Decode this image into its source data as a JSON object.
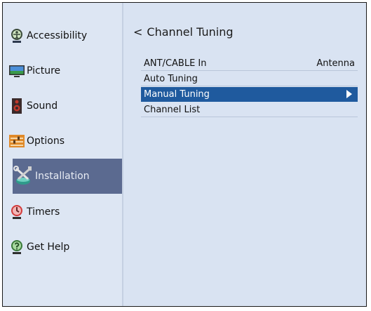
{
  "sidebar": {
    "items": [
      {
        "label": "Accessibility",
        "icon": "accessibility-icon"
      },
      {
        "label": "Picture",
        "icon": "picture-icon"
      },
      {
        "label": "Sound",
        "icon": "speaker-icon"
      },
      {
        "label": "Options",
        "icon": "options-icon"
      },
      {
        "label": "Installation",
        "icon": "tools-icon",
        "active": true
      },
      {
        "label": "Timers",
        "icon": "timer-icon"
      },
      {
        "label": "Get Help",
        "icon": "help-icon"
      }
    ]
  },
  "main": {
    "back_symbol": "<",
    "title": "Channel Tuning",
    "menu": [
      {
        "label": "ANT/CABLE In",
        "value": "Antenna"
      },
      {
        "label": "Auto Tuning",
        "value": ""
      },
      {
        "label": "Manual Tuning",
        "value": "",
        "selected": true
      },
      {
        "label": "Channel List",
        "value": ""
      }
    ]
  },
  "colors": {
    "background": "#d9e3f2",
    "sidebar_active": "#5b6a90",
    "menu_selected": "#1f5a9e"
  }
}
